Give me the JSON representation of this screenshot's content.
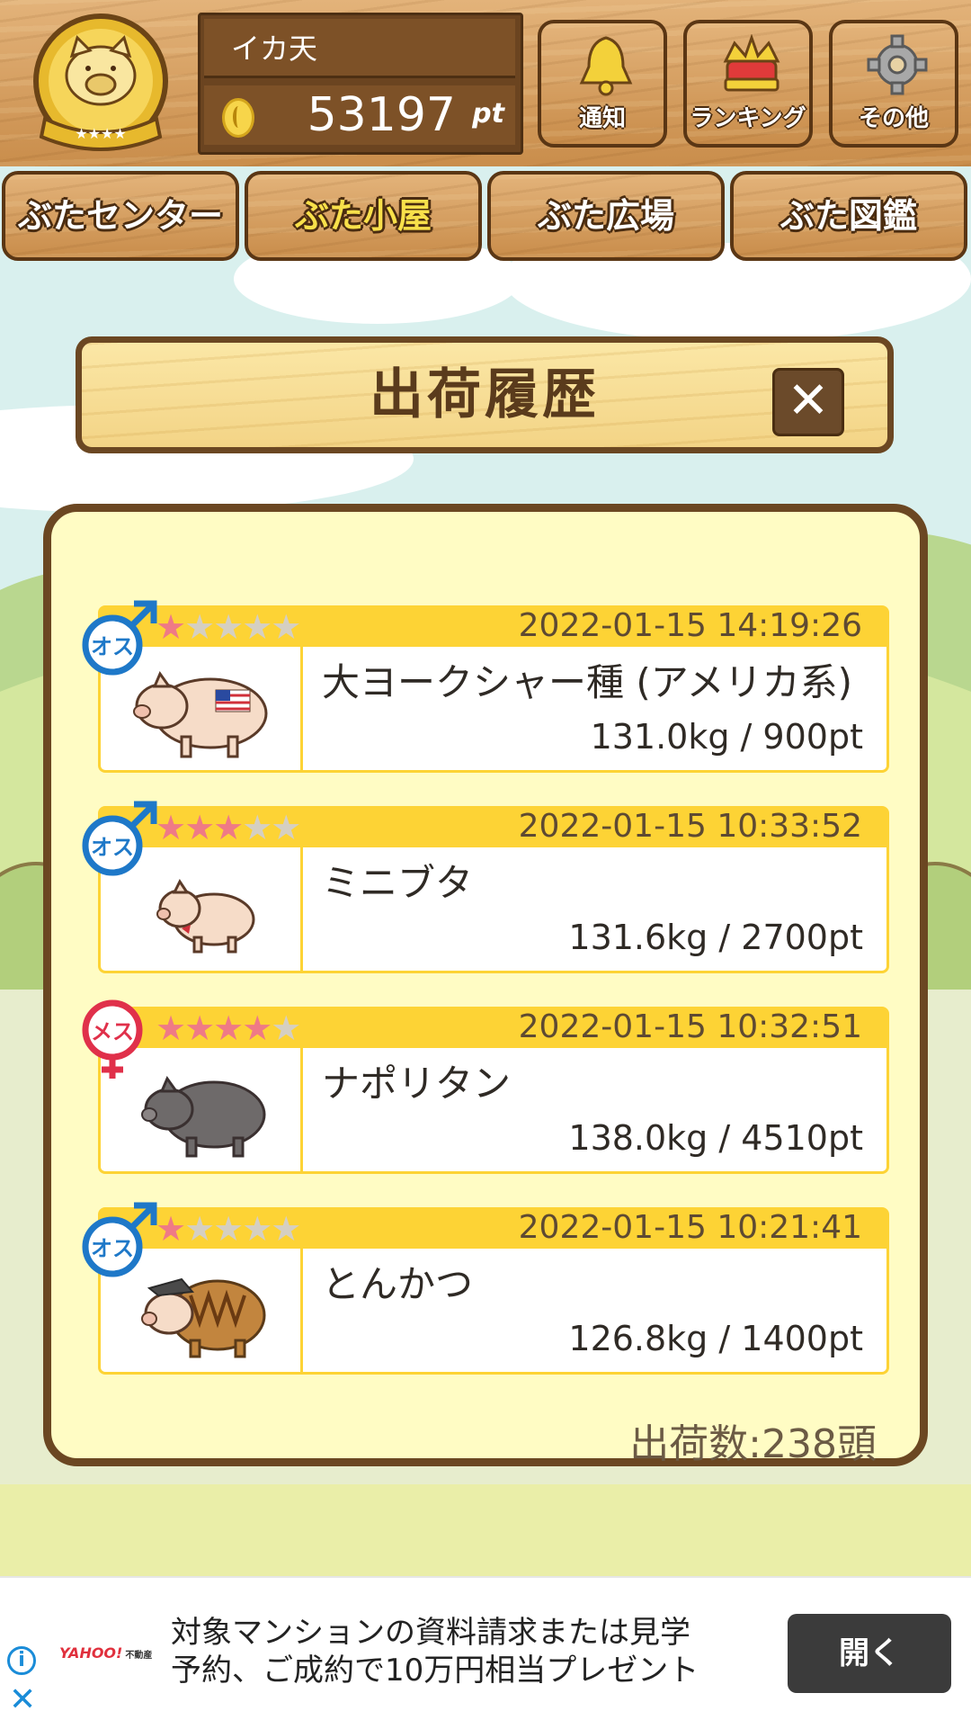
{
  "header": {
    "username": "イカ天",
    "points_value": "53197",
    "points_unit": "pt",
    "buttons": [
      {
        "label": "通知",
        "icon": "bell-icon"
      },
      {
        "label": "ランキング",
        "icon": "crown-icon"
      },
      {
        "label": "その他",
        "icon": "gear-icon"
      }
    ]
  },
  "tabs": [
    {
      "label": "ぶたセンター",
      "active": false
    },
    {
      "label": "ぶた小屋",
      "active": true
    },
    {
      "label": "ぶた広場",
      "active": false
    },
    {
      "label": "ぶた図鑑",
      "active": false
    }
  ],
  "dialog": {
    "title": "出荷履歴",
    "close_label": "✕",
    "count_label": "出荷数:238頭"
  },
  "entries": [
    {
      "gender": "オス",
      "stars": 1,
      "date": "2022-01-15 14:19:26",
      "name": "大ヨークシャー種 (アメリカ系)",
      "stats": "131.0kg / 900pt"
    },
    {
      "gender": "オス",
      "stars": 3,
      "date": "2022-01-15 10:33:52",
      "name": "ミニブタ",
      "stats": "131.6kg / 2700pt"
    },
    {
      "gender": "メス",
      "stars": 4,
      "date": "2022-01-15 10:32:51",
      "name": "ナポリタン",
      "stats": "138.0kg / 4510pt"
    },
    {
      "gender": "オス",
      "stars": 1,
      "date": "2022-01-15 10:21:41",
      "name": "とんかつ",
      "stats": "126.8kg / 1400pt"
    }
  ],
  "ad": {
    "logo": "YAHOO!",
    "logo_sub": "不動産",
    "text": "対象マンションの資料請求または見学予約、ご成約で10万円相当プレゼント",
    "button": "開く"
  },
  "colors": {
    "male": "#1e78c8",
    "female": "#e0304a",
    "star_on": "#ef7a86",
    "star_off": "#d5cfc2",
    "entry_bar": "#fdd335"
  }
}
